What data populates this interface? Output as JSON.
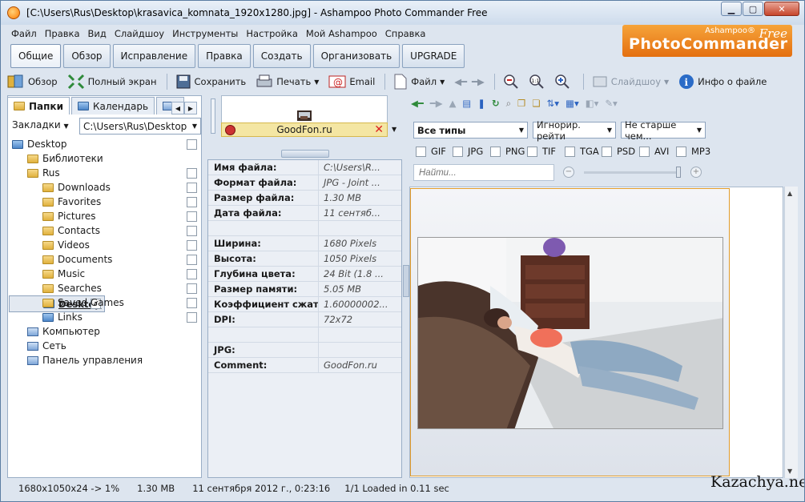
{
  "window": {
    "title": "[C:\\Users\\Rus\\Desktop\\krasavica_komnata_1920x1280.jpg] - Ashampoo Photo Commander Free"
  },
  "brand": {
    "small": "Ashampoo®",
    "big": "PhotoCommander",
    "free": "Free"
  },
  "menu": [
    "Файл",
    "Правка",
    "Вид",
    "Слайдшоу",
    "Инструменты",
    "Настройка",
    "Мой Ashampoo",
    "Справка"
  ],
  "tabs": [
    "Общие",
    "Обзор",
    "Исправление",
    "Правка",
    "Создать",
    "Организовать",
    "UPGRADE"
  ],
  "toolbar": {
    "overview": "Обзор",
    "fullscreen": "Полный экран",
    "save": "Сохранить",
    "print": "Печать",
    "email": "Email",
    "file": "Файл",
    "slideshow": "Слайдшоу",
    "fileinfo": "Инфо о файле"
  },
  "leftpanel": {
    "tab_folders": "Папки",
    "tab_calendar": "Календарь",
    "bookmarks": "Закладки",
    "path": "C:\\Users\\Rus\\Desktop"
  },
  "tree": [
    {
      "label": "Desktop",
      "indent": 0,
      "icon": "blue",
      "chk": false
    },
    {
      "label": "Библиотеки",
      "indent": 1,
      "icon": "yellow",
      "chk": null
    },
    {
      "label": "Rus",
      "indent": 1,
      "icon": "yellow",
      "chk": false
    },
    {
      "label": "Downloads",
      "indent": 2,
      "icon": "yellow",
      "chk": false
    },
    {
      "label": "Favorites",
      "indent": 2,
      "icon": "yellow",
      "chk": false
    },
    {
      "label": "Pictures",
      "indent": 2,
      "icon": "yellow",
      "chk": false
    },
    {
      "label": "Contacts",
      "indent": 2,
      "icon": "yellow",
      "chk": false
    },
    {
      "label": "Videos",
      "indent": 2,
      "icon": "yellow",
      "chk": false
    },
    {
      "label": "Documents",
      "indent": 2,
      "icon": "yellow",
      "chk": false
    },
    {
      "label": "Music",
      "indent": 2,
      "icon": "yellow",
      "chk": false
    },
    {
      "label": "Searches",
      "indent": 2,
      "icon": "yellow",
      "chk": false
    },
    {
      "label": "Desktop",
      "indent": 2,
      "icon": "blue",
      "chk": true,
      "selected": true
    },
    {
      "label": "Saved Games",
      "indent": 2,
      "icon": "yellow",
      "chk": false
    },
    {
      "label": "Links",
      "indent": 2,
      "icon": "blue",
      "chk": false
    },
    {
      "label": "Компьютер",
      "indent": 1,
      "icon": "pc",
      "chk": null
    },
    {
      "label": "Сеть",
      "indent": 1,
      "icon": "pc",
      "chk": null
    },
    {
      "label": "Панель управления",
      "indent": 1,
      "icon": "pc",
      "chk": null
    }
  ],
  "thumb": {
    "label": "GoodFon.ru"
  },
  "props": [
    {
      "k": "Имя файла:",
      "v": "C:\\Users\\R..."
    },
    {
      "k": "Формат файла:",
      "v": "JPG - Joint ..."
    },
    {
      "k": "Размер файла:",
      "v": "1.30 MB"
    },
    {
      "k": "Дата файла:",
      "v": "11 сентяб..."
    },
    {
      "k": "",
      "v": ""
    },
    {
      "k": "Ширина:",
      "v": "1680 Pixels"
    },
    {
      "k": "Высота:",
      "v": "1050 Pixels"
    },
    {
      "k": "Глубина цвета:",
      "v": "24 Bit (1.8 ..."
    },
    {
      "k": "Размер памяти:",
      "v": "5.05 MB"
    },
    {
      "k": "Коэффициент сжатия:",
      "v": "1.60000002..."
    },
    {
      "k": "DPI:",
      "v": "72x72"
    },
    {
      "k": "",
      "v": ""
    },
    {
      "k": "JPG:",
      "v": ""
    },
    {
      "k": "Comment:",
      "v": "GoodFon.ru"
    }
  ],
  "filters": {
    "types": "Все типы",
    "rating": "Игнорир. рейти",
    "age": "Не старше чем...",
    "search_placeholder": "Найти...",
    "exts": [
      "GIF",
      "JPG",
      "PNG",
      "TIF",
      "TGA",
      "PSD",
      "AVI",
      "MP3"
    ]
  },
  "status": {
    "dims": "1680x1050x24 -> 1%",
    "size": "1.30 MB",
    "date": "11 сентября 2012 г., 0:23:16",
    "loaded": "1/1  Loaded in 0.11 sec"
  },
  "watermark": "Kazachya.net"
}
